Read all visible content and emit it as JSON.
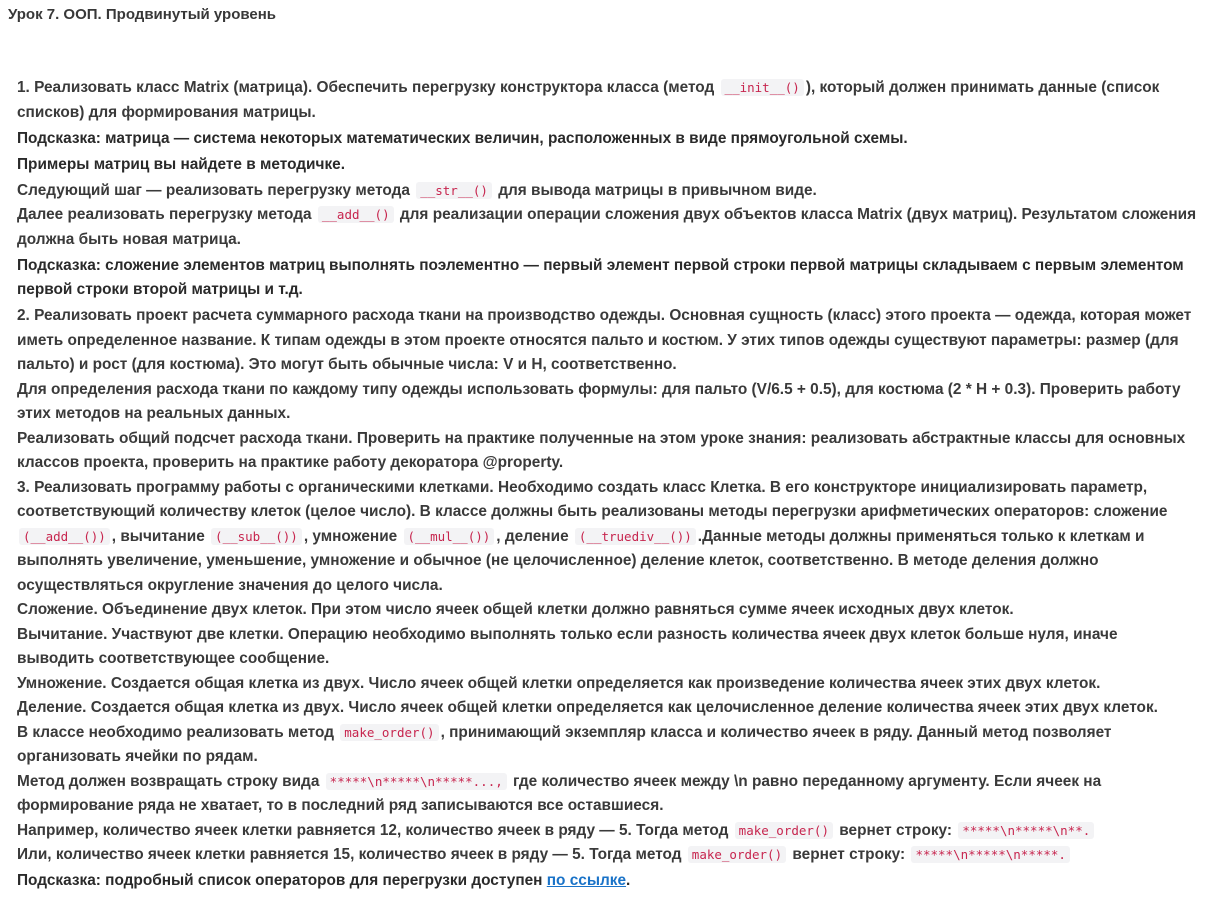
{
  "page": {
    "title": "Урок 7. ООП. Продвинутый уровень"
  },
  "task1": {
    "p1_a": "1. Реализовать класс Matrix (матрица). Обеспечить перегрузку конструктора класса (метод ",
    "p1_code": "__init__()",
    "p1_b": "), который должен принимать данные (список списков) для формирования матрицы.",
    "hint1": "Подсказка: матрица — система некоторых математических величин, расположенных в виде прямоугольной схемы.",
    "hint1_b": "Примеры матриц вы найдете в методичке.",
    "p2_a": "Следующий шаг — реализовать перегрузку метода ",
    "p2_code": "__str__()",
    "p2_b": " для вывода матрицы в привычном виде.",
    "p3_a": "Далее реализовать перегрузку метода ",
    "p3_code": "__add__()",
    "p3_b": " для реализации операции сложения двух объектов класса Matrix (двух матриц). Результатом сложения должна быть новая матрица.",
    "hint2": "Подсказка: сложение элементов матриц выполнять поэлементно — первый элемент первой строки первой матрицы складываем с первым элементом первой строки второй матрицы и т.д."
  },
  "task2": {
    "p1": "2. Реализовать проект расчета суммарного расхода ткани на производство одежды. Основная сущность (класс) этого проекта — одежда, которая может иметь определенное название. К типам одежды в этом проекте относятся пальто и костюм. У этих типов одежды существуют параметры: размер (для пальто) и рост (для костюма). Это могут быть обычные числа: V и H, соответственно.",
    "p2": "Для определения расхода ткани по каждому типу одежды использовать формулы: для пальто (V/6.5 + 0.5), для костюма (2 * H + 0.3). Проверить работу этих методов на реальных данных.",
    "p3": "Реализовать общий подсчет расхода ткани. Проверить на практике полученные на этом уроке знания: реализовать абстрактные классы для основных классов проекта, проверить на практике работу декоратора @property."
  },
  "task3": {
    "p1_a": "3. Реализовать программу работы с органическими клетками. Необходимо создать класс Клетка. В его конструкторе инициализировать параметр, соответствующий количеству клеток (целое число). В классе должны быть реализованы методы перегрузки арифметических операторов: сложение ",
    "code_add": "(__add__())",
    "p1_b": ", вычитание ",
    "code_sub": "(__sub__())",
    "p1_c": ", умножение ",
    "code_mul": "(__mul__())",
    "p1_d": ", деление ",
    "code_div": "(__truediv__())",
    "p1_e": ".Данные методы должны применяться только к клеткам и выполнять увеличение, уменьшение, умножение и обычное (не целочисленное) деление клеток, соответственно. В методе деления должно осуществляться округление значения до целого числа.",
    "p2": "Сложение. Объединение двух клеток. При этом число ячеек общей клетки должно равняться сумме ячеек исходных двух клеток.",
    "p3": "Вычитание. Участвуют две клетки. Операцию необходимо выполнять только если разность количества ячеек двух клеток больше нуля, иначе выводить соответствующее сообщение.",
    "p4": "Умножение. Создается общая клетка из двух. Число ячеек общей клетки определяется как произведение количества ячеек этих двух клеток.",
    "p5": "Деление. Создается общая клетка из двух. Число ячеек общей клетки определяется как целочисленное деление количества ячеек этих двух клеток.",
    "p6_a": "В классе необходимо реализовать метод ",
    "p6_code": "make_order()",
    "p6_b": ", принимающий экземпляр класса и количество ячеек в ряду. Данный метод позволяет организовать ячейки по рядам.",
    "p7_a": "Метод должен возвращать строку вида ",
    "p7_code": "*****\\n*****\\n*****...,",
    "p7_b": " где количество ячеек между \\n равно переданному аргументу. Если ячеек на формирование ряда не хватает, то в последний ряд записываются все оставшиеся.",
    "p8_a": "Например, количество ячеек клетки равняется 12, количество ячеек в ряду — 5. Тогда метод ",
    "p8_code1": "make_order()",
    "p8_b": " вернет строку: ",
    "p8_code2": "*****\\n*****\\n**.",
    "p9_a": "Или, количество ячеек клетки равняется 15, количество ячеек в ряду — 5. Тогда метод ",
    "p9_code1": "make_order()",
    "p9_b": " вернет строку: ",
    "p9_code2": "*****\\n*****\\n*****.",
    "hint_a": "Подсказка: подробный список операторов для перегрузки доступен ",
    "hint_link": "по ссылке",
    "hint_b": "."
  }
}
